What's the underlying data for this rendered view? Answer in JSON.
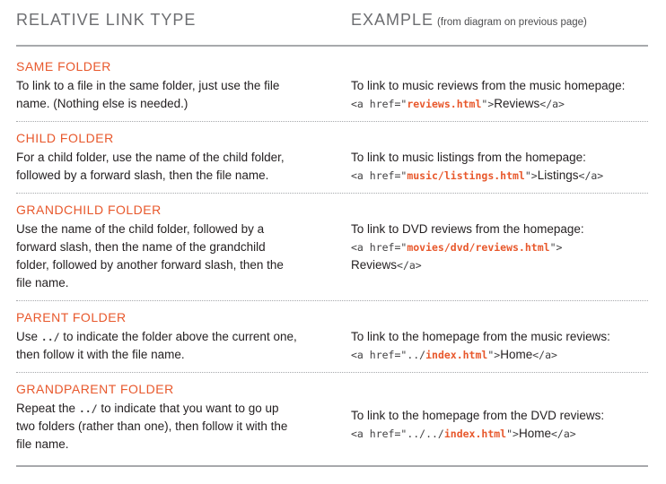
{
  "header": {
    "left_title": "RELATIVE LINK TYPE",
    "right_title": "EXAMPLE",
    "right_subtitle": "(from diagram on previous page)"
  },
  "rows": [
    {
      "title": "SAME FOLDER",
      "description": [
        "To link to a file in the same folder, just use the file",
        "name. (Nothing else is needed.)"
      ],
      "example_text": "To link to music reviews from the music homepage:",
      "code": {
        "open": "<a href=\"",
        "path": "reviews.html",
        "close": "\">",
        "link_text": "Reviews",
        "end": "</a>"
      }
    },
    {
      "title": "CHILD FOLDER",
      "description": [
        "For a child folder, use the name of the child folder,",
        "followed by a forward slash, then the file name."
      ],
      "example_text": "To link to music listings from the homepage:",
      "code": {
        "open": "<a href=\"",
        "path": "music/listings.html",
        "close": "\">",
        "link_text": "Listings",
        "end": "</a>"
      }
    },
    {
      "title": "GRANDCHILD FOLDER",
      "description": [
        "Use the name of the child folder, followed by a",
        "forward slash, then the name of the grandchild",
        "folder, followed by another forward slash, then the",
        "file name."
      ],
      "example_text": "To link to DVD reviews from the homepage:",
      "code": {
        "open": "<a href=\"",
        "path": "movies/dvd/reviews.html",
        "close": "\">",
        "link_text": "Reviews",
        "end": "</a>"
      }
    },
    {
      "title": "PARENT FOLDER",
      "description": {
        "pre": "Use ",
        "code": "../",
        "post": " to indicate the folder above the current one,",
        "line2": "then follow it with the file name."
      },
      "example_text": "To link to the homepage from the music reviews:",
      "code": {
        "open": "<a href=\"",
        "path_plain": "../",
        "path": "index.html",
        "close": "\">",
        "link_text": "Home",
        "end": "</a>"
      }
    },
    {
      "title": "GRANDPARENT FOLDER",
      "description": {
        "pre": "Repeat the ",
        "code": "../",
        "post": " to indicate that you want to go up",
        "line2": "two folders (rather than one), then follow it with the",
        "line3": "file name."
      },
      "example_text": "To link to the homepage from the DVD reviews:",
      "code": {
        "open": "<a href=\"",
        "path_plain": "../../",
        "path": "index.html",
        "close": "\">",
        "link_text": "Home",
        "end": "</a>"
      }
    }
  ],
  "colors": {
    "accent": "#e8582c",
    "rule": "#a7a9ac",
    "header_text": "#6d6e71"
  }
}
